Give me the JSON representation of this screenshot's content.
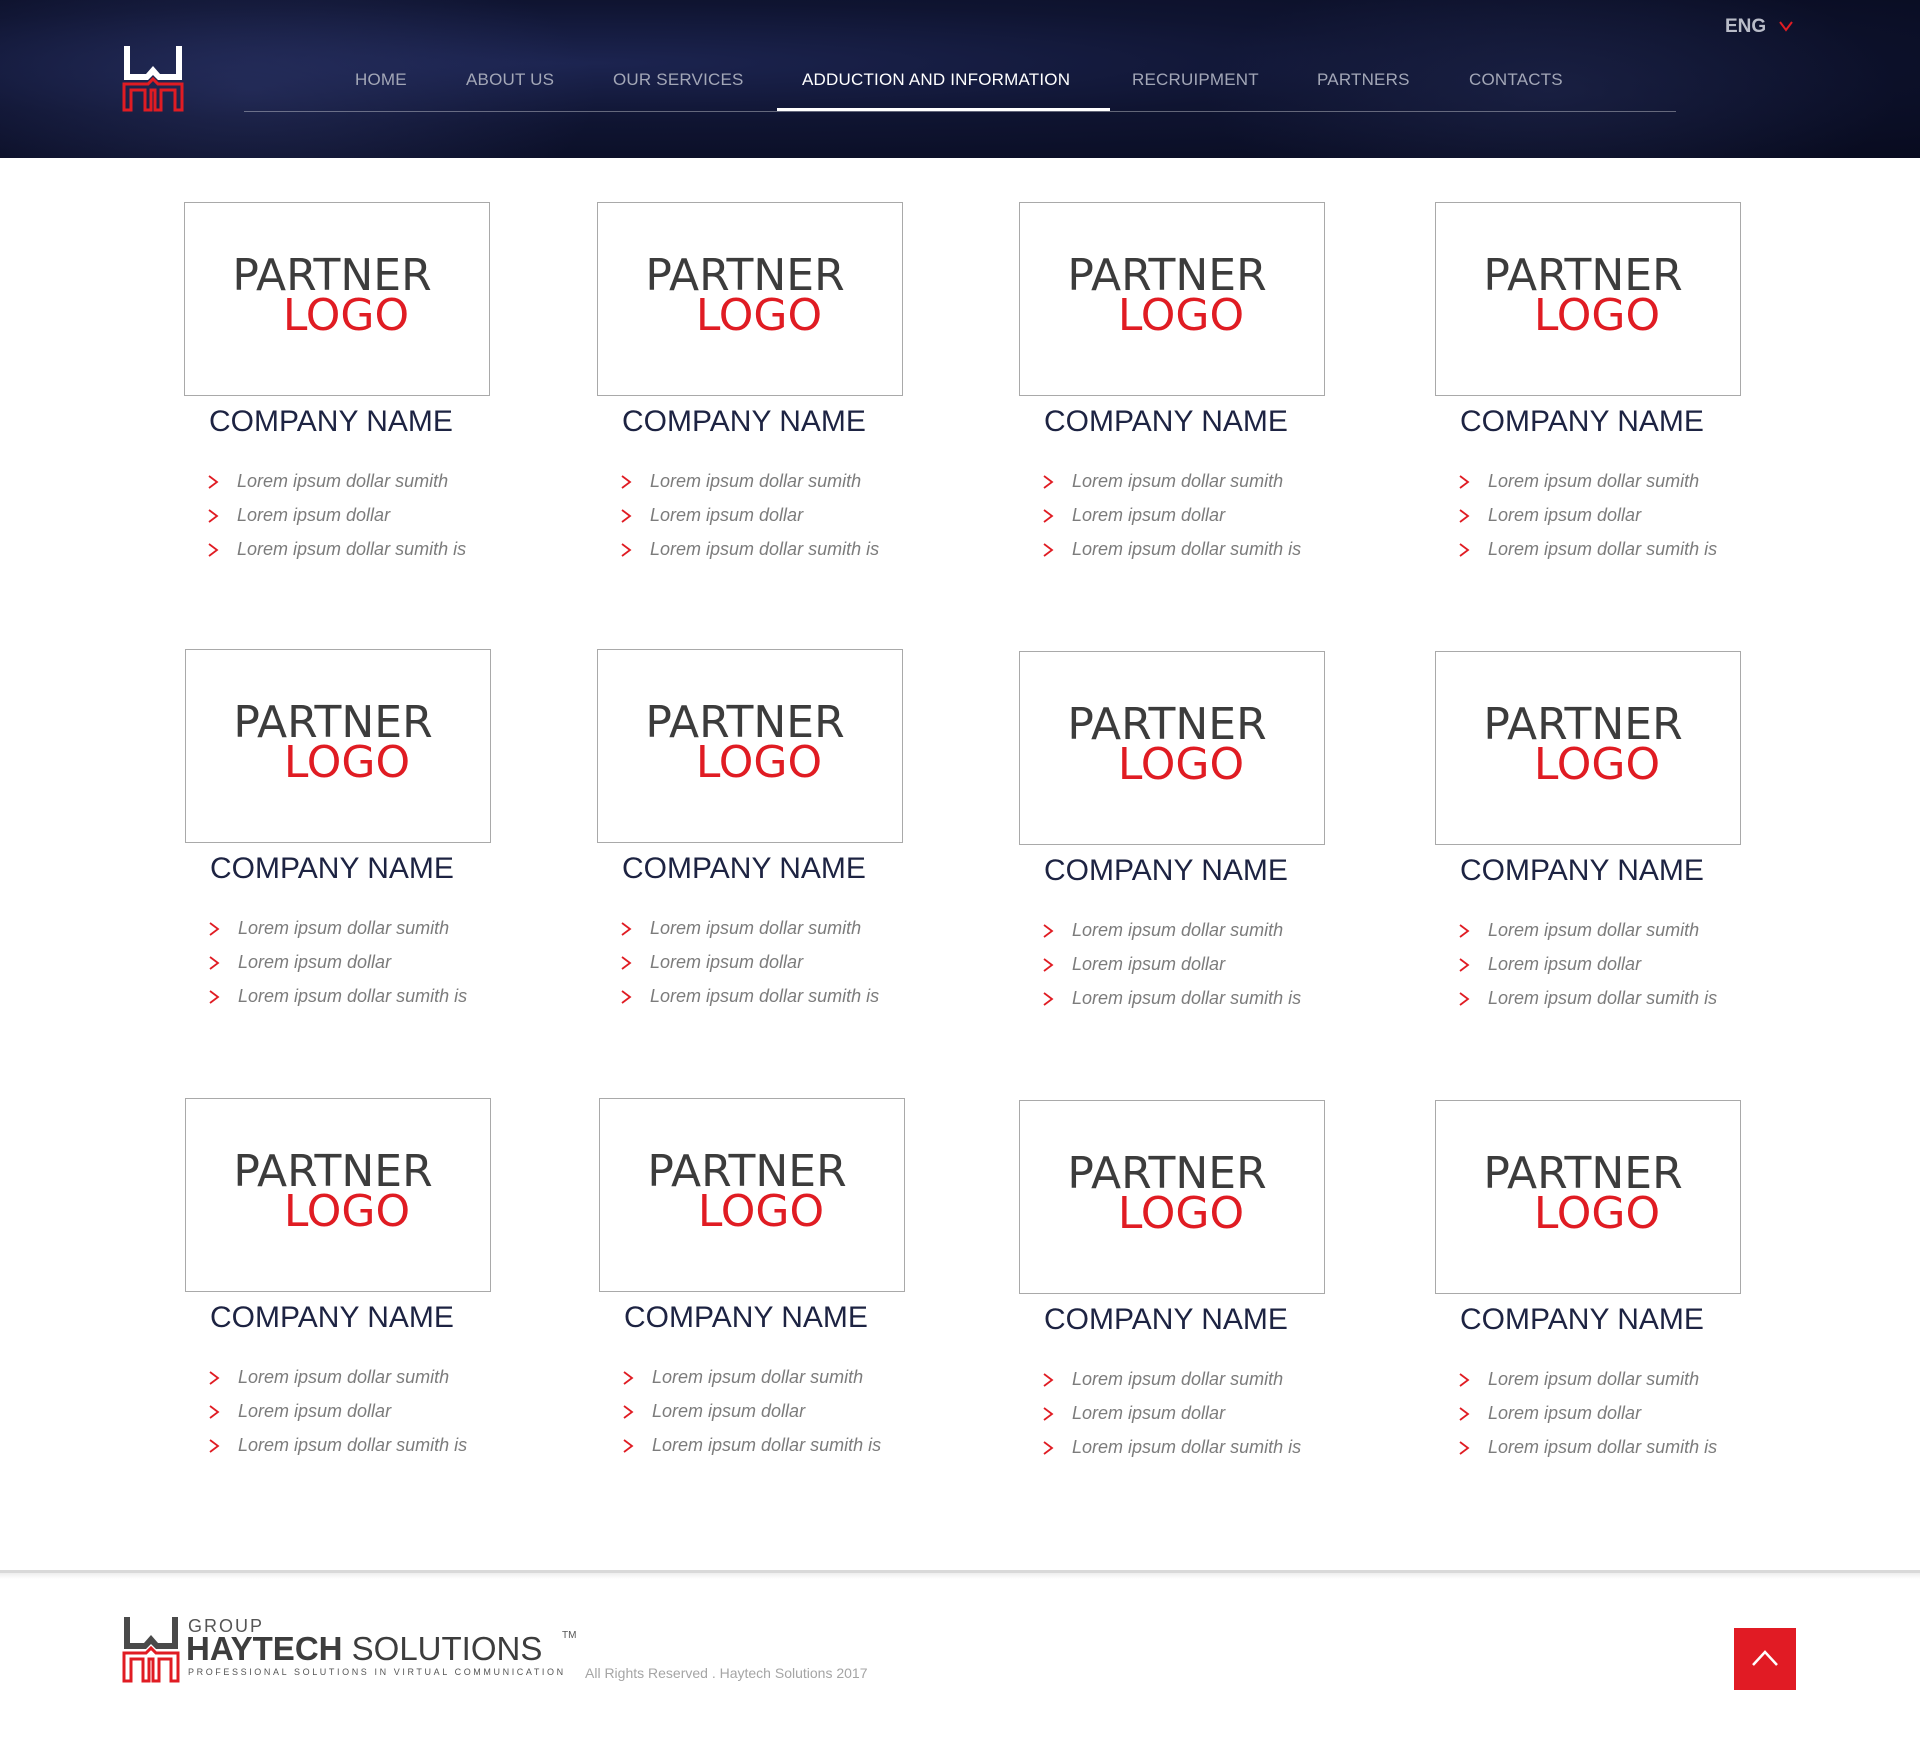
{
  "nav": {
    "items": [
      {
        "label": "HOME",
        "active": false
      },
      {
        "label": "ABOUT US",
        "active": false
      },
      {
        "label": "OUR SERVICES",
        "active": false
      },
      {
        "label": "ADDUCTION AND INFORMATION",
        "active": true
      },
      {
        "label": "RECRUIPMENT",
        "active": false
      },
      {
        "label": "PARTNERS",
        "active": false
      },
      {
        "label": "CONTACTS",
        "active": false
      }
    ],
    "language": "ENG"
  },
  "partners": [
    {
      "logo_line1": "PARTNER",
      "logo_line2": "LOGO",
      "name": "COMPANY NAME",
      "features": [
        "Lorem ipsum dollar sumith",
        "Lorem ipsum dollar",
        "Lorem ipsum dollar sumith is"
      ]
    },
    {
      "logo_line1": "PARTNER",
      "logo_line2": "LOGO",
      "name": "COMPANY NAME",
      "features": [
        "Lorem ipsum dollar sumith",
        "Lorem ipsum dollar",
        "Lorem ipsum dollar sumith is"
      ]
    },
    {
      "logo_line1": "PARTNER",
      "logo_line2": "LOGO",
      "name": "COMPANY NAME",
      "features": [
        "Lorem ipsum dollar sumith",
        "Lorem ipsum dollar",
        "Lorem ipsum dollar sumith is"
      ]
    },
    {
      "logo_line1": "PARTNER",
      "logo_line2": "LOGO",
      "name": "COMPANY NAME",
      "features": [
        "Lorem ipsum dollar sumith",
        "Lorem ipsum dollar",
        "Lorem ipsum dollar sumith is"
      ]
    },
    {
      "logo_line1": "PARTNER",
      "logo_line2": "LOGO",
      "name": "COMPANY NAME",
      "features": [
        "Lorem ipsum dollar sumith",
        "Lorem ipsum dollar",
        "Lorem ipsum dollar sumith is"
      ]
    },
    {
      "logo_line1": "PARTNER",
      "logo_line2": "LOGO",
      "name": "COMPANY NAME",
      "features": [
        "Lorem ipsum dollar sumith",
        "Lorem ipsum dollar",
        "Lorem ipsum dollar sumith is"
      ]
    },
    {
      "logo_line1": "PARTNER",
      "logo_line2": "LOGO",
      "name": "COMPANY NAME",
      "features": [
        "Lorem ipsum dollar sumith",
        "Lorem ipsum dollar",
        "Lorem ipsum dollar sumith is"
      ]
    },
    {
      "logo_line1": "PARTNER",
      "logo_line2": "LOGO",
      "name": "COMPANY NAME",
      "features": [
        "Lorem ipsum dollar sumith",
        "Lorem ipsum dollar",
        "Lorem ipsum dollar sumith is"
      ]
    },
    {
      "logo_line1": "PARTNER",
      "logo_line2": "LOGO",
      "name": "COMPANY NAME",
      "features": [
        "Lorem ipsum dollar sumith",
        "Lorem ipsum dollar",
        "Lorem ipsum dollar sumith is"
      ]
    },
    {
      "logo_line1": "PARTNER",
      "logo_line2": "LOGO",
      "name": "COMPANY NAME",
      "features": [
        "Lorem ipsum dollar sumith",
        "Lorem ipsum dollar",
        "Lorem ipsum dollar sumith is"
      ]
    },
    {
      "logo_line1": "PARTNER",
      "logo_line2": "LOGO",
      "name": "COMPANY NAME",
      "features": [
        "Lorem ipsum dollar sumith",
        "Lorem ipsum dollar",
        "Lorem ipsum dollar sumith is"
      ]
    },
    {
      "logo_line1": "PARTNER",
      "logo_line2": "LOGO",
      "name": "COMPANY NAME",
      "features": [
        "Lorem ipsum dollar sumith",
        "Lorem ipsum dollar",
        "Lorem ipsum dollar sumith is"
      ]
    }
  ],
  "footer": {
    "brand_group": "GROUP",
    "brand_bold": "HAYTECH",
    "brand_light": " SOLUTIONS",
    "trademark": "TM",
    "tagline": "PROFESSIONAL SOLUTIONS IN VIRTUAL COMMUNICATION",
    "copyright": "All Rights Reserved . Haytech Solutions 2017"
  },
  "colors": {
    "accent_red": "#e01c23",
    "header_navy": "#0f1431",
    "company_name": "#1d2342"
  },
  "icons": {
    "brand_logo": "haytech-h-icon",
    "language_dropdown": "chevron-down-icon",
    "list_bullet": "chevron-right-icon",
    "scroll_top": "chevron-up-icon"
  }
}
